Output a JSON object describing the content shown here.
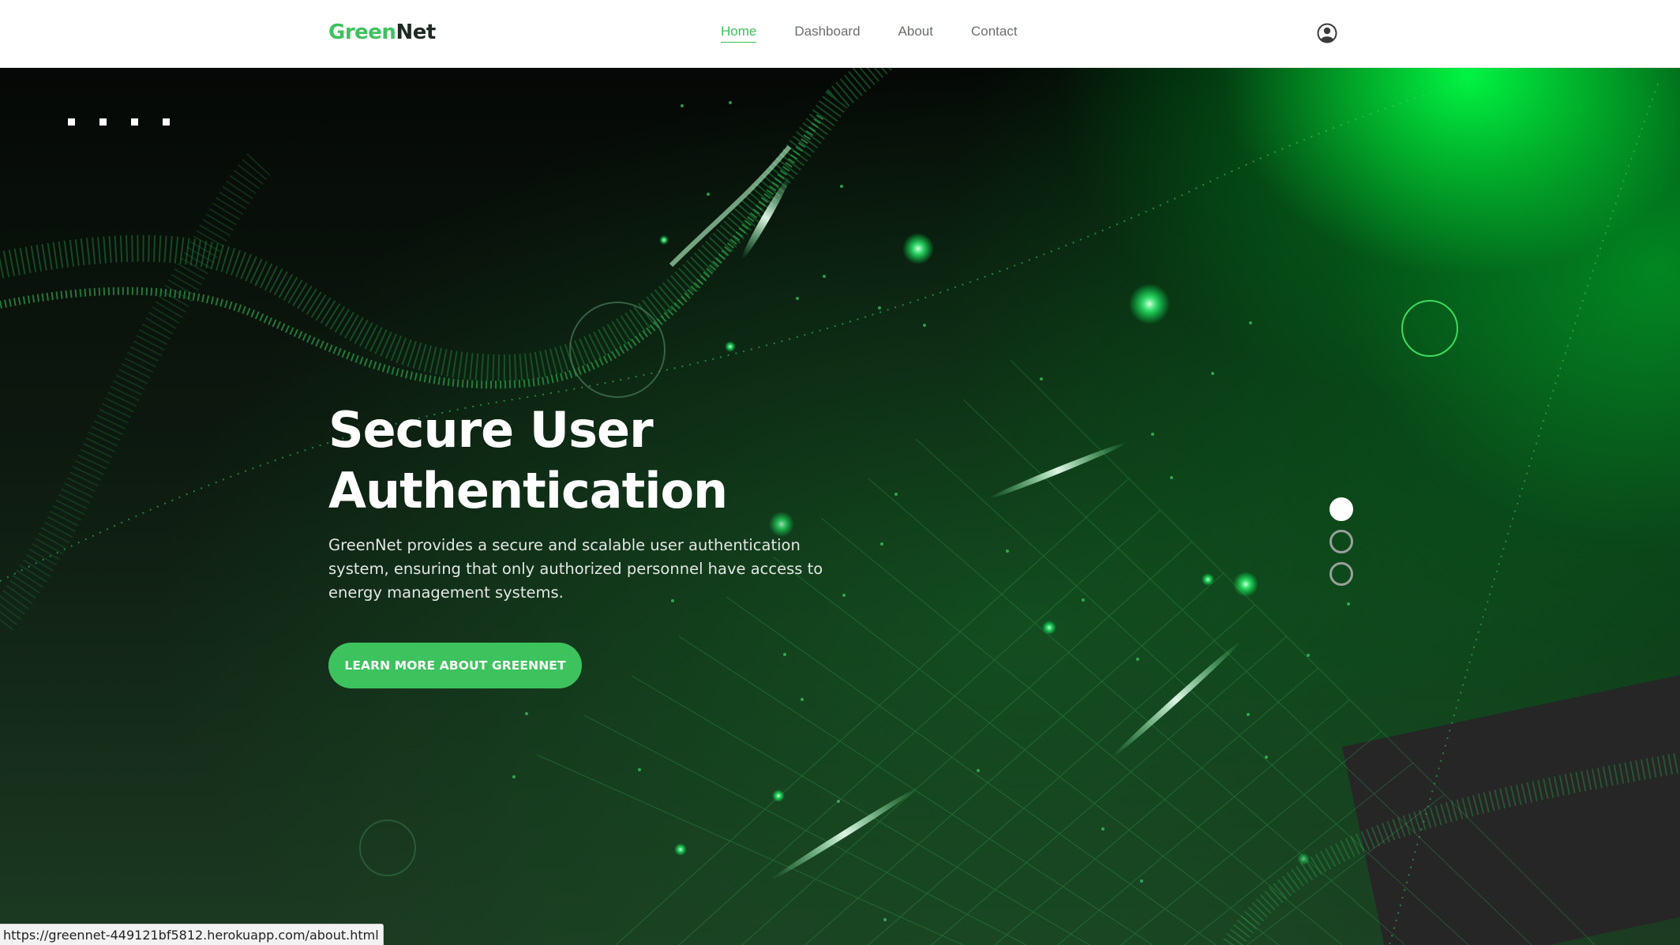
{
  "brand": {
    "part1": "Green",
    "part2": "Net",
    "accent": "#3cc35d",
    "dark": "#1e2a22"
  },
  "nav": {
    "items": [
      {
        "label": "Home",
        "active": true
      },
      {
        "label": "Dashboard",
        "active": false
      },
      {
        "label": "About",
        "active": false
      },
      {
        "label": "Contact",
        "active": false
      }
    ],
    "user_icon": "user-circle-icon"
  },
  "hero": {
    "title_line1": "Secure User",
    "title_line2": "Authentication",
    "description": "GreenNet provides a secure and scalable user authentication system, ensuring that only authorized personnel have access to energy management systems.",
    "cta_label": "LEARN MORE ABOUT GREENNET",
    "slide_count": 3,
    "active_slide": 1
  },
  "status_bar": {
    "url": "https://greennet-449121bf5812.herokuapp.com/about.html"
  }
}
